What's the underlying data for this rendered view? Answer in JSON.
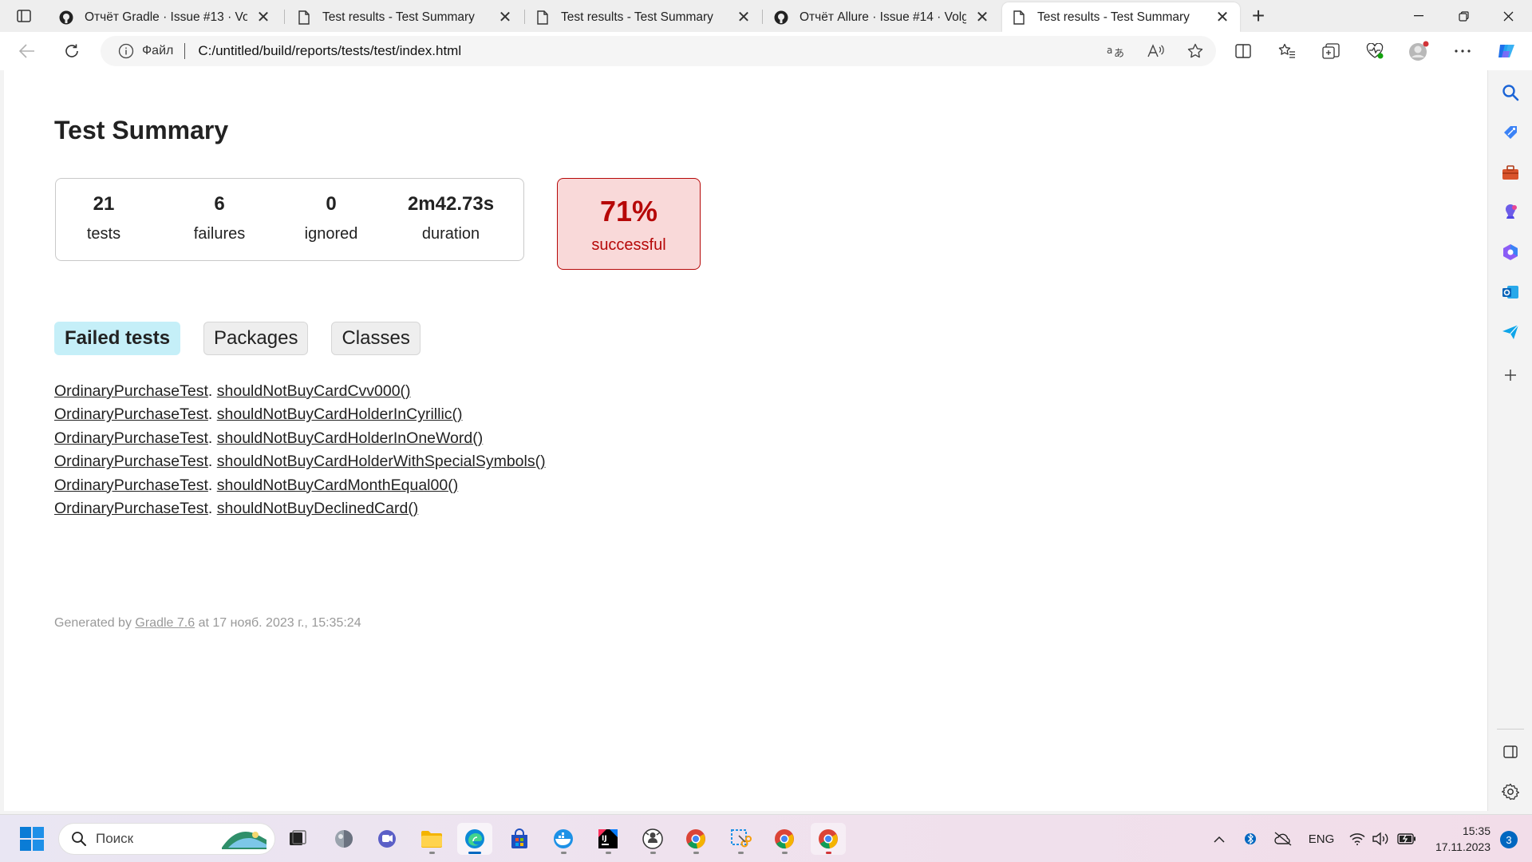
{
  "browser": {
    "tabs": [
      {
        "title": "Отчёт Gradle · Issue #13 · Volgog",
        "icon": "github-icon"
      },
      {
        "title": "Test results - Test Summary",
        "icon": "page-icon"
      },
      {
        "title": "Test results - Test Summary",
        "icon": "page-icon"
      },
      {
        "title": "Отчёт Allure · Issue #14 · Volgog",
        "icon": "github-icon"
      },
      {
        "title": "Test results - Test Summary",
        "icon": "page-icon",
        "active": true
      }
    ],
    "close_glyph": "✕",
    "new_tab_glyph": "+",
    "address": {
      "scheme_label": "Файл",
      "url": "C:/untitled/build/reports/tests/test/index.html"
    }
  },
  "report": {
    "title": "Test Summary",
    "counters": [
      {
        "value": "21",
        "label": "tests"
      },
      {
        "value": "6",
        "label": "failures"
      },
      {
        "value": "0",
        "label": "ignored"
      },
      {
        "value": "2m42.73s",
        "label": "duration"
      }
    ],
    "success": {
      "percent": "71%",
      "label": "successful"
    },
    "tabs": [
      {
        "label": "Failed tests",
        "selected": true
      },
      {
        "label": "Packages"
      },
      {
        "label": "Classes"
      }
    ],
    "failed_tests": [
      {
        "class": "OrdinaryPurchaseTest",
        "method": "shouldNotBuyCardCvv000()"
      },
      {
        "class": "OrdinaryPurchaseTest",
        "method": "shouldNotBuyCardHolderInCyrillic()"
      },
      {
        "class": "OrdinaryPurchaseTest",
        "method": "shouldNotBuyCardHolderInOneWord()"
      },
      {
        "class": "OrdinaryPurchaseTest",
        "method": "shouldNotBuyCardHolderWithSpecialSymbols()"
      },
      {
        "class": "OrdinaryPurchaseTest",
        "method": "shouldNotBuyCardMonthEqual00()"
      },
      {
        "class": "OrdinaryPurchaseTest",
        "method": "shouldNotBuyDeclinedCard()"
      }
    ],
    "footer": {
      "prefix": "Generated by ",
      "link": "Gradle 7.6",
      "suffix": " at 17 нояб. 2023 г., 15:35:24"
    },
    "colors": {
      "failure": "#b60808",
      "failure_bg": "#f9d9d9",
      "selected_tab": "#c5eff8"
    }
  },
  "taskbar": {
    "search_placeholder": "Поиск",
    "language": "ENG",
    "time": "15:35",
    "date": "17.11.2023",
    "notifications": "3"
  }
}
